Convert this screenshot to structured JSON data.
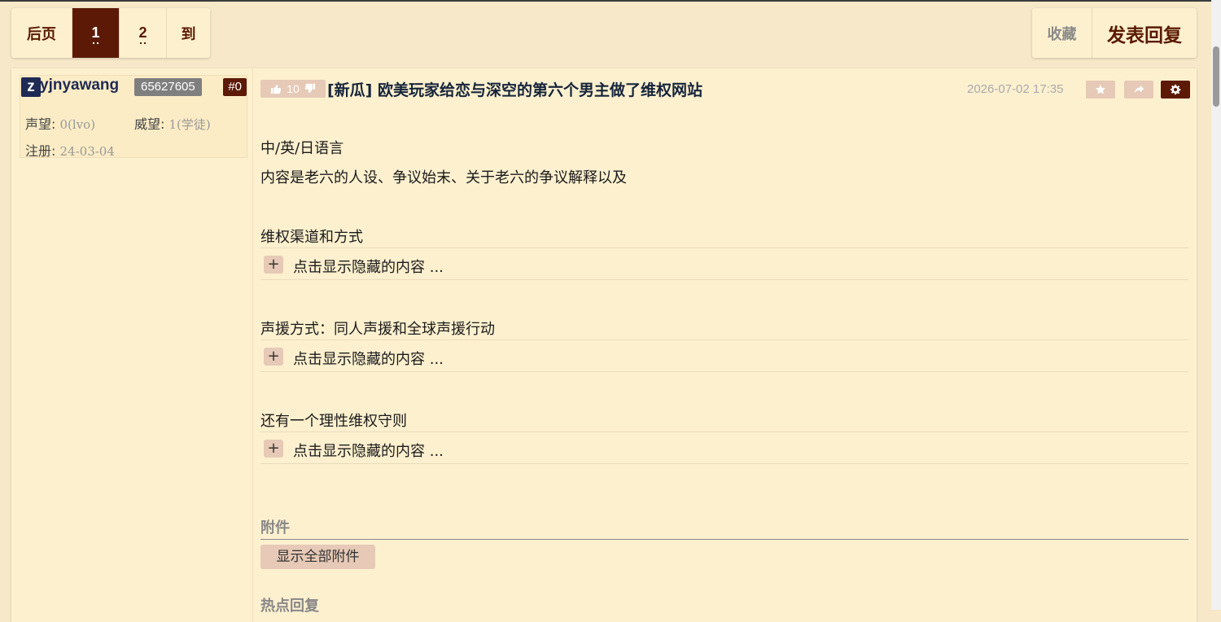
{
  "pager": {
    "prev_label": "后页",
    "page1_label": "1",
    "page2_label": "2",
    "goto_label": "到"
  },
  "actions": {
    "favorite_label": "收藏",
    "reply_label": "发表回复"
  },
  "user": {
    "avatar_letter": "z",
    "name": "yjnyawang",
    "uid": "65627605",
    "floor": "#0",
    "fame_label": "声望:",
    "fame_value": "0(lvo)",
    "power_label": "威望:",
    "power_value": "1(学徒)",
    "reg_label": "注册:",
    "reg_value": "24-03-04"
  },
  "post": {
    "like_count": "10",
    "title": "[新瓜] 欧美玩家给恋与深空的第六个男主做了维权网站",
    "date": "2026-07-02 17:35",
    "line1": "中/英/日语言",
    "line2": "内容是老六的人设、争议始末、关于老六的争议解释以及",
    "section1": "维权渠道和方式",
    "section2": "声援方式：同人声援和全球声援行动",
    "section3": "还有一个理性维权守则",
    "hidden_label": "点击显示隐藏的内容 ...",
    "plus_symbol": "+",
    "attachments_title": "附件",
    "show_all_attachments": "显示全部附件",
    "hot_replies_title": "热点回复"
  },
  "icons": {
    "like": "thumbs-up-icon",
    "dislike": "thumbs-down-icon",
    "star": "star-icon",
    "share": "share-icon",
    "gear": "gear-icon"
  },
  "colors": {
    "accent": "#5c1a06",
    "background": "#f6e8c9",
    "panel": "#fdf0cf",
    "button_muted": "#e6c9b6",
    "title_text": "#15243a"
  }
}
